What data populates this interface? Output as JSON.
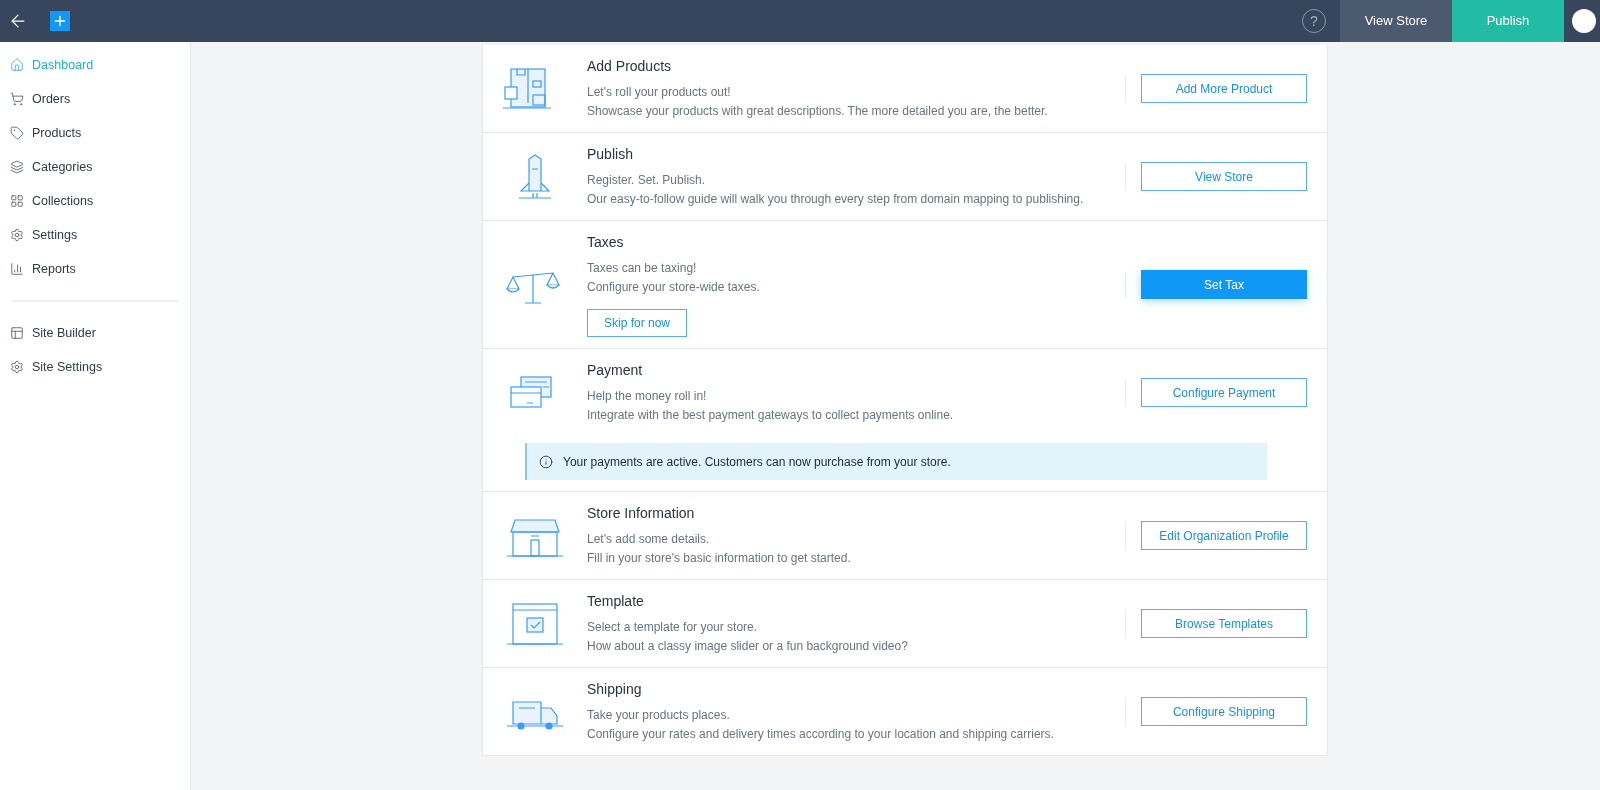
{
  "top_bar": {
    "help": "?",
    "buttons": [
      {
        "label": "View Store",
        "kind": "secondary"
      },
      {
        "label": "Publish",
        "kind": "accent"
      }
    ]
  },
  "sidebar": {
    "groups": [
      [
        {
          "label": "Dashboard",
          "selected": true
        },
        {
          "label": "Orders",
          "selected": false
        },
        {
          "label": "Products",
          "selected": false
        },
        {
          "label": "Categories",
          "selected": false
        },
        {
          "label": "Collections",
          "selected": false
        },
        {
          "label": "Settings",
          "selected": false
        },
        {
          "label": "Reports",
          "selected": false
        }
      ],
      [
        {
          "label": "Site Builder",
          "selected": false
        },
        {
          "label": "Site Settings",
          "selected": false
        }
      ]
    ]
  },
  "sections": [
    {
      "title": "Add Products",
      "lines": [
        "Let's roll your products out!",
        "Showcase your products with great descriptions. The more detailed you are, the better."
      ],
      "action": {
        "label": "Add More Product",
        "kind": "outline"
      }
    },
    {
      "title": "Publish",
      "lines": [
        "Register. Set. Publish.",
        "Our easy-to-follow guide will walk you through every step from domain mapping to publishing."
      ],
      "action": {
        "label": "View Store",
        "kind": "outline"
      }
    },
    {
      "title": "Taxes",
      "lines": [
        "Taxes can be taxing!",
        "Configure your store-wide taxes."
      ],
      "secondary_action": "Skip for now",
      "action": {
        "label": "Set Tax",
        "kind": "primary"
      }
    },
    {
      "title": "Payment",
      "lines": [
        "Help the money roll in!",
        "Integrate with the best payment gateways to collect payments online."
      ],
      "action": {
        "label": "Configure Payment",
        "kind": "outline"
      },
      "notice": "Your payments are active. Customers can now purchase from your store."
    },
    {
      "title": "Store Information",
      "lines": [
        "Let's add some details.",
        "Fill in your store's basic information to get started."
      ],
      "action": {
        "label": "Edit Organization Profile",
        "kind": "outline"
      }
    },
    {
      "title": "Template",
      "lines": [
        "Select a template for your store.",
        "How about a classy image slider or a fun background video?"
      ],
      "action": {
        "label": "Browse Templates",
        "kind": "outline"
      }
    },
    {
      "title": "Shipping",
      "lines": [
        "Take your products places.",
        "Configure your rates and delivery times according to your location and shipping carriers."
      ],
      "action": {
        "label": "Configure Shipping",
        "kind": "outline"
      }
    }
  ]
}
